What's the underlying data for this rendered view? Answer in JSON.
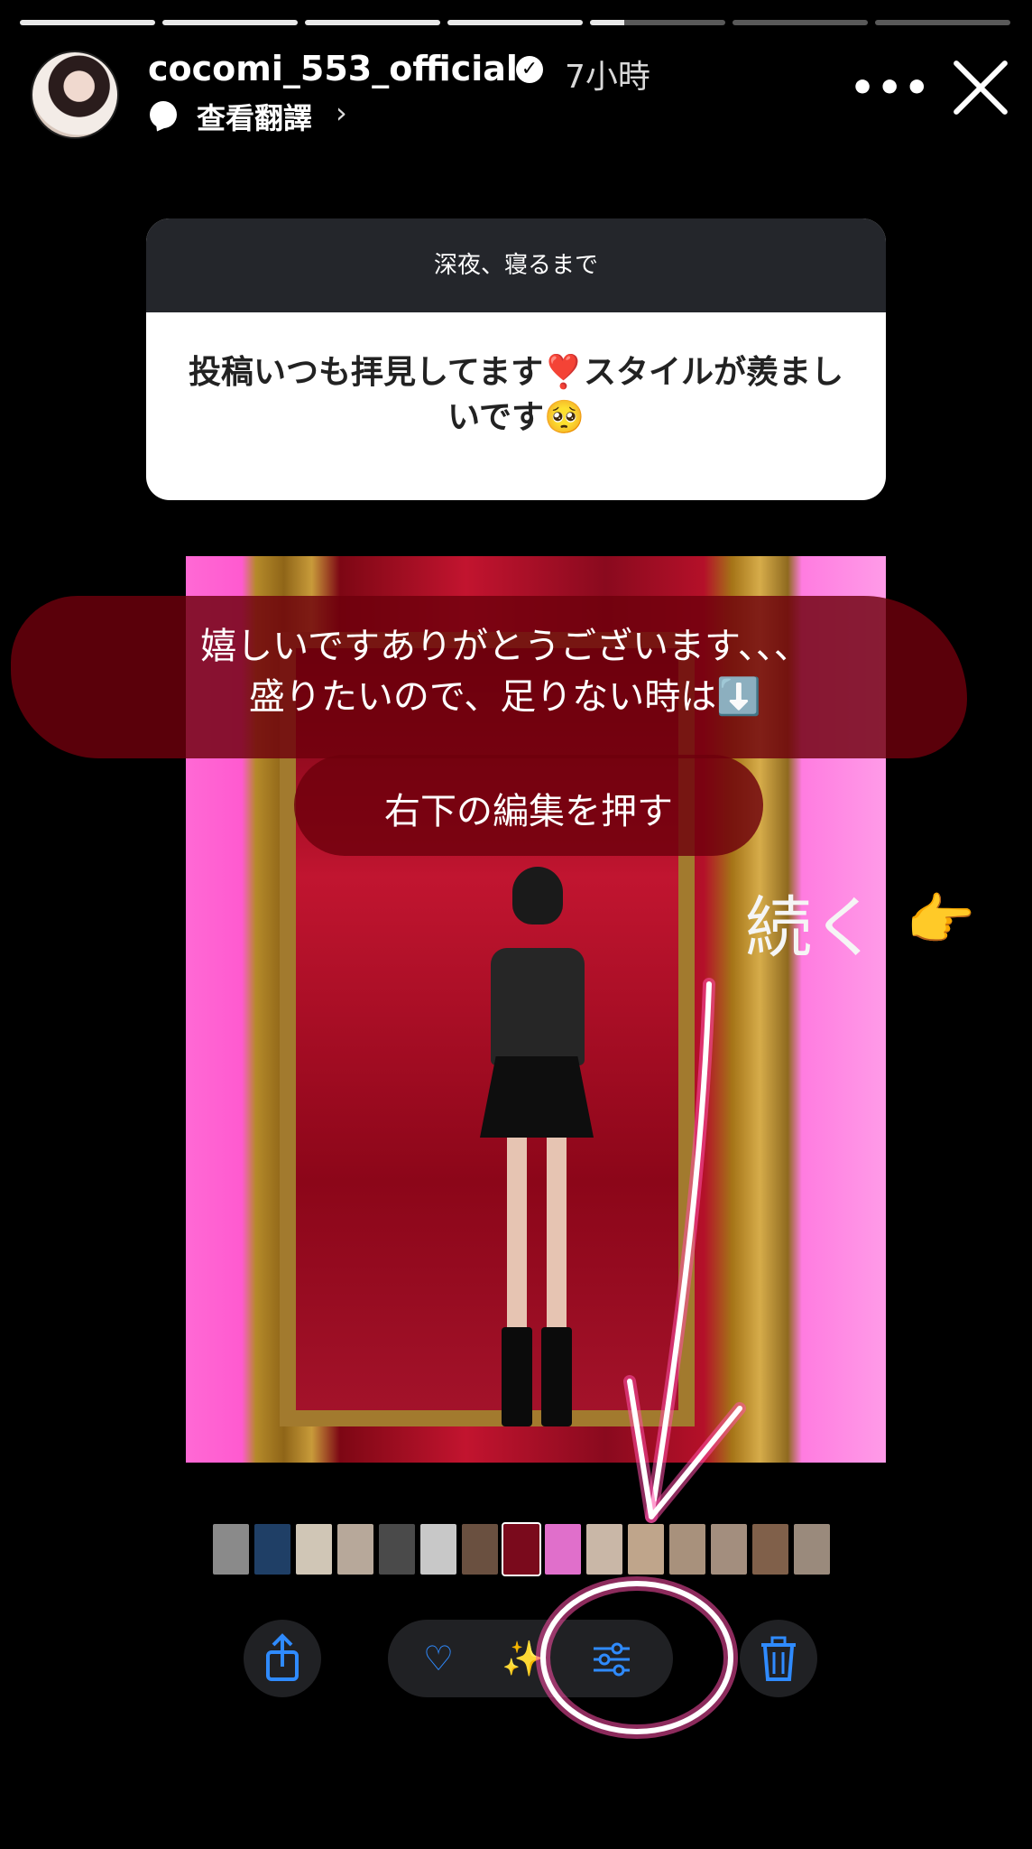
{
  "story": {
    "segments": 7,
    "current_segment": 5,
    "current_progress": 0.25
  },
  "header": {
    "username": "cocomi_553_official",
    "verified_icon": "verified-badge-icon",
    "time": "7小時",
    "translate": "查看翻譯",
    "more": "•••",
    "close_icon": "close-icon"
  },
  "question": {
    "header": "深夜、寝るまで",
    "text": "投稿いつも拝見してます❣️スタイルが羨ましいです🥺"
  },
  "caption": {
    "line1": "嬉しいですありがとうございます、、、",
    "line2": "盛りたいので、足りない時は⬇️",
    "line3": "右下の編集を押す"
  },
  "continue_text": "続く",
  "pointing_icon": "👉",
  "filmstrip": {
    "thumbs": [
      "#8a8a8a",
      "#1f3f66",
      "#d0c6b6",
      "#b7a89a",
      "#4a4a4a",
      "#c8c8c8",
      "#6a5040",
      "#7a0a1c",
      "#e06fcb",
      "#c9b7a7",
      "#bfa58b",
      "#a8917c",
      "#a38e7e",
      "#80604a",
      "#9a8a7c"
    ]
  },
  "toolbar": {
    "share_icon": "share-icon",
    "favorite_icon": "heart-icon",
    "enhance_icon": "magic-enhance-icon",
    "edit_icon": "sliders-edit-icon",
    "delete_icon": "trash-icon"
  },
  "colors": {
    "toolbar_accent": "#2f8bff",
    "annotation_pink": "#ff4fa8"
  }
}
